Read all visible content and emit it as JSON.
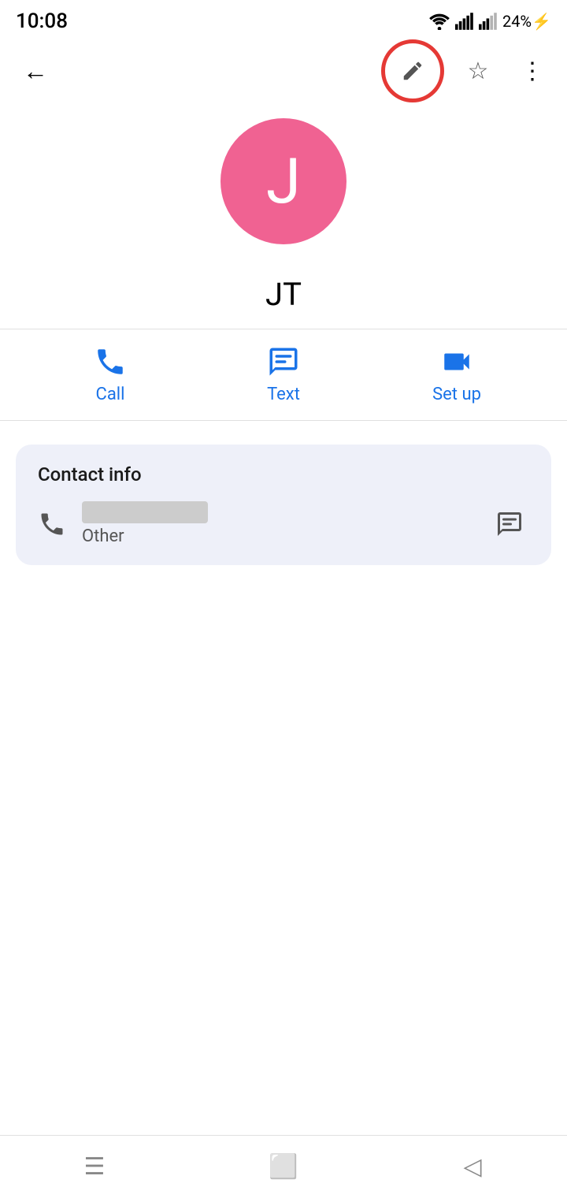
{
  "statusBar": {
    "time": "10:08",
    "battery": "24%",
    "batteryIcon": "⚡"
  },
  "appBar": {
    "backLabel": "←",
    "editIcon": "✏",
    "starIcon": "☆",
    "moreIcon": "⋮"
  },
  "avatar": {
    "letter": "J",
    "bgColor": "#f06292"
  },
  "contact": {
    "name": "JT"
  },
  "actions": [
    {
      "id": "call",
      "label": "Call",
      "icon": "call"
    },
    {
      "id": "text",
      "label": "Text",
      "icon": "text"
    },
    {
      "id": "setup",
      "label": "Set up",
      "icon": "video"
    }
  ],
  "contactInfo": {
    "title": "Contact info",
    "phoneLabel": "Other",
    "phoneIcon": "phone",
    "messageIcon": "message"
  },
  "navBar": {
    "menuIcon": "☰",
    "homeIcon": "⬜",
    "backIcon": "◁"
  }
}
